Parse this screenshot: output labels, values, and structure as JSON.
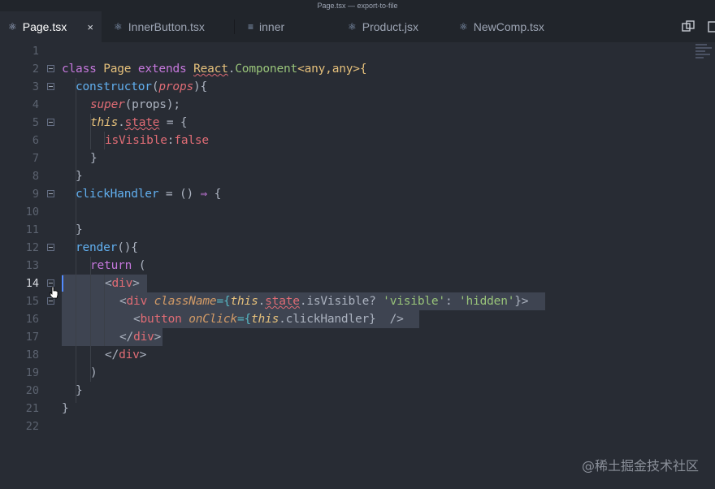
{
  "window": {
    "title": "Page.tsx — export-to-file"
  },
  "tabs": [
    {
      "label": "Page.tsx",
      "icon": "react-icon",
      "active": true
    },
    {
      "label": "InnerButton.tsx",
      "icon": "react-icon",
      "active": false
    },
    {
      "label": "inner",
      "icon": "file-text-icon",
      "active": false
    },
    {
      "label": "Product.jsx",
      "icon": "react-icon",
      "active": false
    },
    {
      "label": "NewComp.tsx",
      "icon": "react-icon",
      "active": false
    }
  ],
  "tab_close_glyph": "×",
  "editor": {
    "current_line": 14,
    "line_numbers": [
      "1",
      "2",
      "3",
      "4",
      "5",
      "6",
      "7",
      "8",
      "9",
      "10",
      "11",
      "12",
      "13",
      "14",
      "15",
      "16",
      "17",
      "18",
      "19",
      "20",
      "21",
      "22"
    ],
    "code": {
      "l2": {
        "a": "class",
        "b": "Page",
        "c": "extends",
        "d": "React",
        "e": ".",
        "f": "Component",
        "g": "<any,any>{"
      },
      "l3": {
        "a": "constructor",
        "b": "(",
        "c": "props",
        "d": "){"
      },
      "l4": {
        "a": "super",
        "b": "(props);"
      },
      "l5": {
        "a": "this",
        "b": ".",
        "c": "state",
        "d": " = {"
      },
      "l6": {
        "a": "isVisible",
        "b": ":",
        "c": "false"
      },
      "l7": {
        "a": "}"
      },
      "l8": {
        "a": "}"
      },
      "l9": {
        "a": "clickHandler",
        "b": " = () ",
        "c": "⇒",
        "d": " {"
      },
      "l11": {
        "a": "}"
      },
      "l12": {
        "a": "render",
        "b": "(){"
      },
      "l13": {
        "a": "return",
        "b": " ("
      },
      "l14": {
        "a": "<",
        "b": "div",
        "c": ">"
      },
      "l15": {
        "a": "<",
        "b": "div",
        "c": " ",
        "d": "className",
        "e": "={",
        "f": "this",
        "g": ".",
        "h": "state",
        "i": ".isVisible? ",
        "j": "'visible'",
        "k": ": ",
        "l": "'hidden'",
        "m": "}>"
      },
      "l16": {
        "a": "<",
        "b": "button",
        "c": " ",
        "d": "onClick",
        "e": "={",
        "f": "this",
        "g": ".clickHandler}",
        "h": "  />"
      },
      "l17": {
        "a": "</",
        "b": "div",
        "c": ">"
      },
      "l18": {
        "a": "</",
        "b": "div",
        "c": ">"
      },
      "l19": {
        "a": ")"
      },
      "l20": {
        "a": "}"
      },
      "l21": {
        "a": "}"
      }
    }
  },
  "watermark": "@稀土掘金技术社区",
  "colors": {
    "background": "#282c34",
    "selection": "#3e4451",
    "keyword": "#c678dd",
    "class": "#e5c07b",
    "function": "#61afef",
    "string": "#98c379",
    "tag": "#e06c75"
  }
}
